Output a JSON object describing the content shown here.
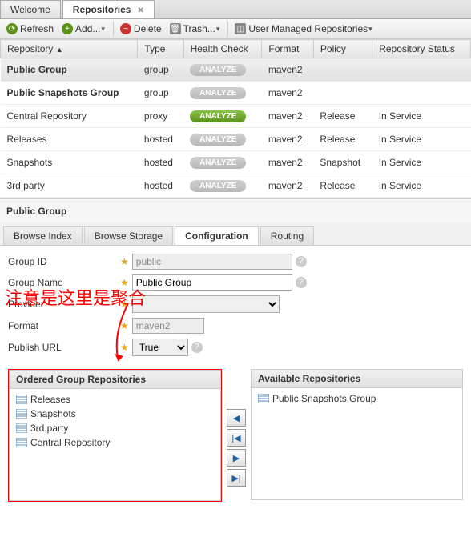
{
  "tabs": {
    "welcome": "Welcome",
    "repositories": "Repositories"
  },
  "toolbar": {
    "refresh": "Refresh",
    "add": "Add...",
    "delete": "Delete",
    "trash": "Trash...",
    "user_managed": "User Managed Repositories"
  },
  "columns": {
    "repository": "Repository",
    "type": "Type",
    "health": "Health Check",
    "format": "Format",
    "policy": "Policy",
    "status": "Repository Status"
  },
  "analyze_label": "ANALYZE",
  "rows": [
    {
      "name": "Public Group",
      "type": "group",
      "format": "maven2",
      "policy": "",
      "status": "",
      "green": false,
      "sel": true,
      "bold": true
    },
    {
      "name": "Public Snapshots Group",
      "type": "group",
      "format": "maven2",
      "policy": "",
      "status": "",
      "green": false,
      "bold": true
    },
    {
      "name": "Central Repository",
      "type": "proxy",
      "format": "maven2",
      "policy": "Release",
      "status": "In Service",
      "green": true
    },
    {
      "name": "Releases",
      "type": "hosted",
      "format": "maven2",
      "policy": "Release",
      "status": "In Service",
      "green": false
    },
    {
      "name": "Snapshots",
      "type": "hosted",
      "format": "maven2",
      "policy": "Snapshot",
      "status": "In Service",
      "green": false
    },
    {
      "name": "3rd party",
      "type": "hosted",
      "format": "maven2",
      "policy": "Release",
      "status": "In Service",
      "green": false
    }
  ],
  "detail": {
    "title": "Public Group"
  },
  "sub_tabs": {
    "browse_index": "Browse Index",
    "browse_storage": "Browse Storage",
    "configuration": "Configuration",
    "routing": "Routing"
  },
  "form": {
    "group_id_label": "Group ID",
    "group_id": "public",
    "group_name_label": "Group Name",
    "group_name": "Public Group",
    "provider_label": "Provider",
    "provider": "",
    "format_label": "Format",
    "format": "maven2",
    "publish_url_label": "Publish URL",
    "publish_url": "True"
  },
  "annotation": "注意是这里是聚合",
  "repo": {
    "ordered": "Ordered Group Repositories",
    "available": "Available Repositories",
    "ordered_list": [
      "Releases",
      "Snapshots",
      "3rd party",
      "Central Repository"
    ],
    "available_list": [
      "Public Snapshots Group"
    ]
  }
}
